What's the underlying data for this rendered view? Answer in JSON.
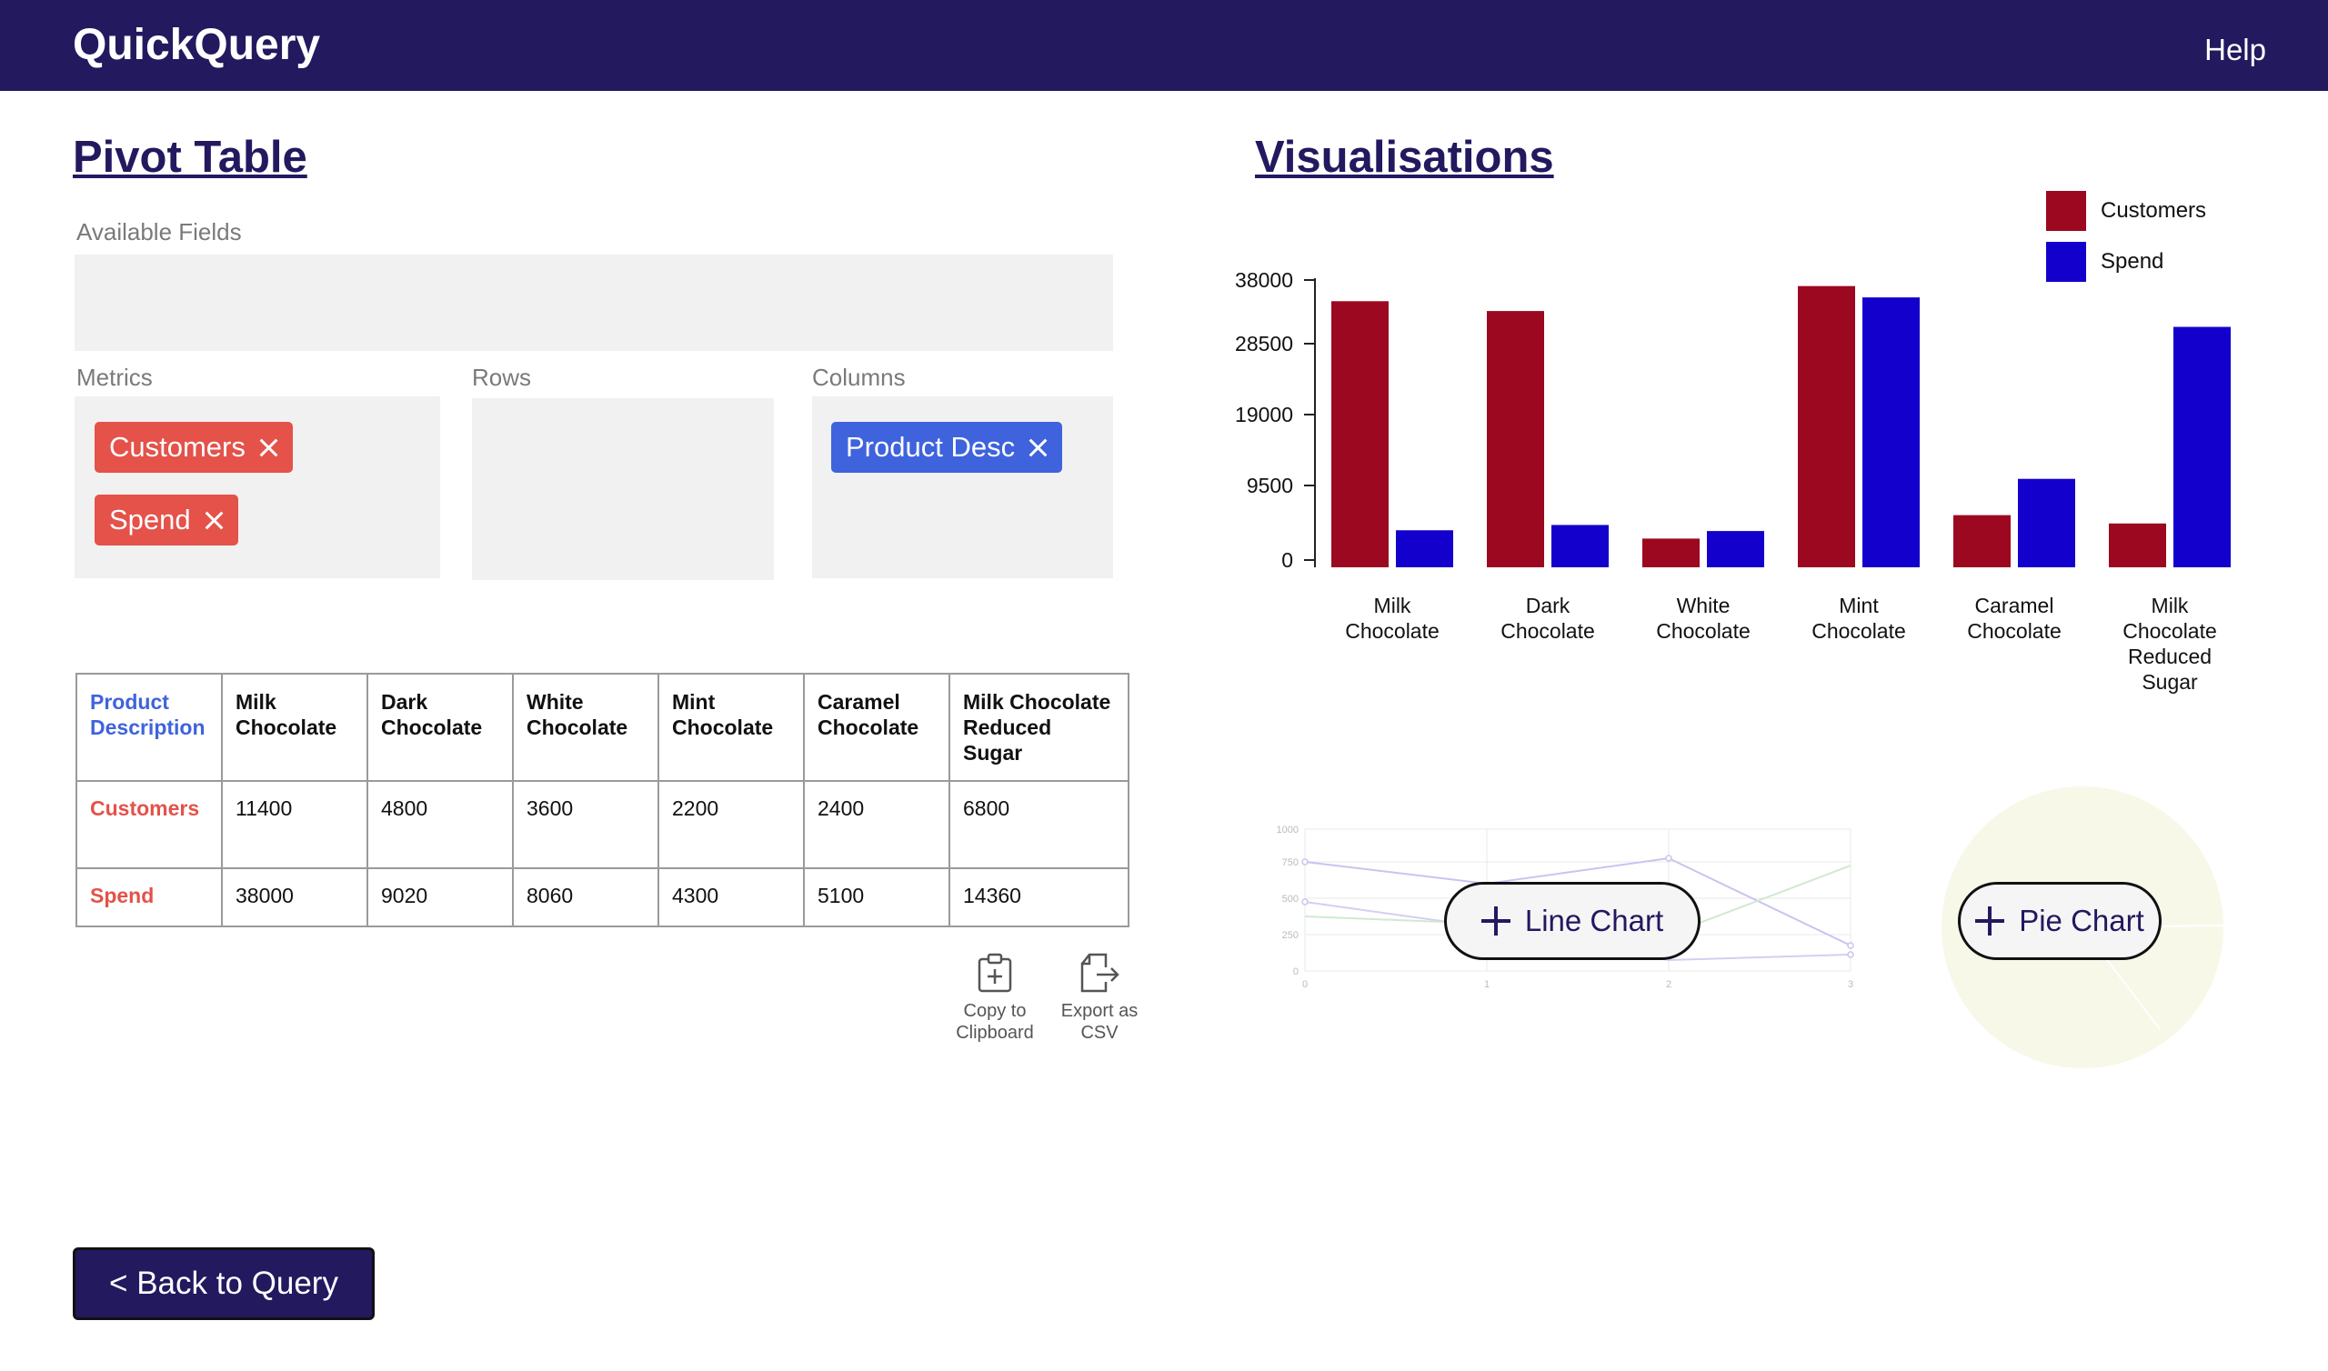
{
  "app": {
    "title": "QuickQuery",
    "help_label": "Help"
  },
  "pivot": {
    "title": "Pivot Table",
    "available_fields_label": "Available Fields",
    "metrics_label": "Metrics",
    "rows_label": "Rows",
    "columns_label": "Columns",
    "metrics_chips": [
      "Customers",
      "Spend"
    ],
    "columns_chips": [
      "Product Desc"
    ],
    "table": {
      "corner": "Product Description",
      "headers": [
        "Milk Chocolate",
        "Dark Chocolate",
        "White Chocolate",
        "Mint Chocolate",
        "Caramel Chocolate",
        "Milk Chocolate Reduced Sugar"
      ],
      "rows": [
        {
          "label": "Customers",
          "values": [
            "11400",
            "4800",
            "3600",
            "2200",
            "2400",
            "6800"
          ]
        },
        {
          "label": "Spend",
          "values": [
            "38000",
            "9020",
            "8060",
            "4300",
            "5100",
            "14360"
          ]
        }
      ]
    },
    "tools": {
      "copy_label": "Copy to Clipboard",
      "export_label": "Export as CSV"
    }
  },
  "back_button_label": "< Back to Query",
  "visualisations": {
    "title": "Visualisations",
    "add_line_chart_label": "Line Chart",
    "add_pie_chart_label": "Pie Chart",
    "line_preview_ticks": {
      "y": [
        "1000",
        "750",
        "500",
        "250",
        "0"
      ],
      "x": [
        "0",
        "1",
        "2",
        "3"
      ]
    }
  },
  "colors": {
    "header": "#22195f",
    "customers": "#9b0820",
    "spend": "#1300cc",
    "chip_red": "#e4524a",
    "chip_blue": "#3f63dd"
  },
  "chart_data": {
    "type": "bar",
    "categories": [
      "Milk Chocolate",
      "Dark Chocolate",
      "White Chocolate",
      "Mint Chocolate",
      "Caramel Chocolate",
      "Milk Chocolate Reduced Sugar"
    ],
    "series": [
      {
        "name": "Customers",
        "values": [
          35200,
          33900,
          3800,
          37200,
          6900,
          5800
        ]
      },
      {
        "name": "Spend",
        "values": [
          4900,
          5600,
          4800,
          35700,
          11700,
          31800
        ]
      }
    ],
    "y_ticks": [
      "38000",
      "28500",
      "19000",
      "9500",
      "0"
    ],
    "ylim": [
      0,
      38000
    ],
    "legend_position": "top-right",
    "grid": false
  }
}
